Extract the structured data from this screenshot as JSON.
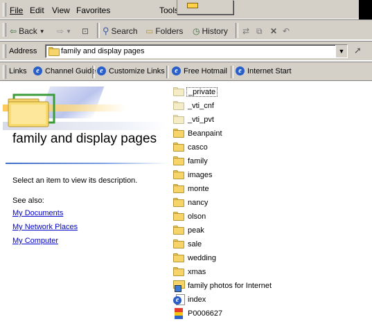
{
  "menu": [
    "File",
    "Edit",
    "View",
    "Favorites",
    "Tools"
  ],
  "toolbar": {
    "back_label": "Back",
    "search_label": "Search",
    "folders_label": "Folders",
    "history_label": "History"
  },
  "address": {
    "label": "Address",
    "value": "family and display pages"
  },
  "links": {
    "label": "Links",
    "items": [
      "Channel Guide",
      "Customize Links",
      "Free Hotmail",
      "Internet Start"
    ]
  },
  "panel": {
    "title": "family and display pages",
    "description": "Select an item to view its description.",
    "see_also": "See also:",
    "other_places": [
      "My Documents",
      "My Network Places",
      "My Computer"
    ]
  },
  "files": [
    {
      "name": "_private",
      "icon": "folder-plain-icon"
    },
    {
      "name": "_vti_cnf",
      "icon": "folder-plain-icon"
    },
    {
      "name": "_vti_pvt",
      "icon": "folder-plain-icon"
    },
    {
      "name": "Beanpaint",
      "icon": "folder-icon"
    },
    {
      "name": "casco",
      "icon": "folder-icon"
    },
    {
      "name": "family",
      "icon": "folder-icon"
    },
    {
      "name": "images",
      "icon": "folder-icon"
    },
    {
      "name": "monte",
      "icon": "folder-icon"
    },
    {
      "name": "nancy",
      "icon": "folder-icon"
    },
    {
      "name": "olson",
      "icon": "folder-icon"
    },
    {
      "name": "peak",
      "icon": "folder-icon"
    },
    {
      "name": "sale",
      "icon": "folder-icon"
    },
    {
      "name": "wedding",
      "icon": "folder-icon"
    },
    {
      "name": "xmas",
      "icon": "folder-icon"
    },
    {
      "name": "family photos for Internet",
      "icon": "photo-folder-icon"
    },
    {
      "name": "index",
      "icon": "html-file-icon"
    },
    {
      "name": "P0006627",
      "icon": "image-file-icon"
    }
  ],
  "selected_file": "_private"
}
